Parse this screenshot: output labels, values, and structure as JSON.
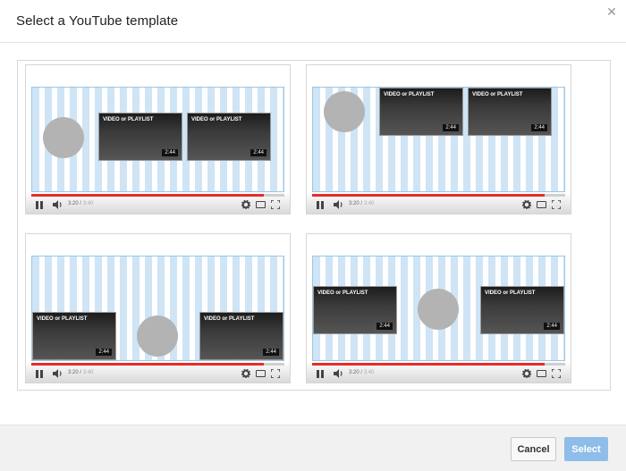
{
  "dialog": {
    "title": "Select a YouTube template",
    "close_icon": "close-icon"
  },
  "templates": [
    {
      "videos": [
        {
          "title": "VIDEO or PLAYLIST",
          "duration": "2:44"
        },
        {
          "title": "VIDEO or PLAYLIST",
          "duration": "2:44"
        }
      ],
      "time": "3:20",
      "duration": "3:40"
    },
    {
      "videos": [
        {
          "title": "VIDEO or PLAYLIST",
          "duration": "2:44"
        },
        {
          "title": "VIDEO or PLAYLIST",
          "duration": "2:44"
        }
      ],
      "time": "3:20",
      "duration": "3:40"
    },
    {
      "videos": [
        {
          "title": "VIDEO or PLAYLIST",
          "duration": "2:44"
        },
        {
          "title": "VIDEO or PLAYLIST",
          "duration": "2:44"
        }
      ],
      "time": "3:20",
      "duration": "3:40"
    },
    {
      "videos": [
        {
          "title": "VIDEO or PLAYLIST",
          "duration": "2:44"
        },
        {
          "title": "VIDEO or PLAYLIST",
          "duration": "2:44"
        }
      ],
      "time": "3:20",
      "duration": "3:40"
    }
  ],
  "footer": {
    "cancel_label": "Cancel",
    "select_label": "Select"
  },
  "colors": {
    "accent": "#8fbde9",
    "progress": "#e52d27",
    "stripe": "#cfe4f5"
  }
}
